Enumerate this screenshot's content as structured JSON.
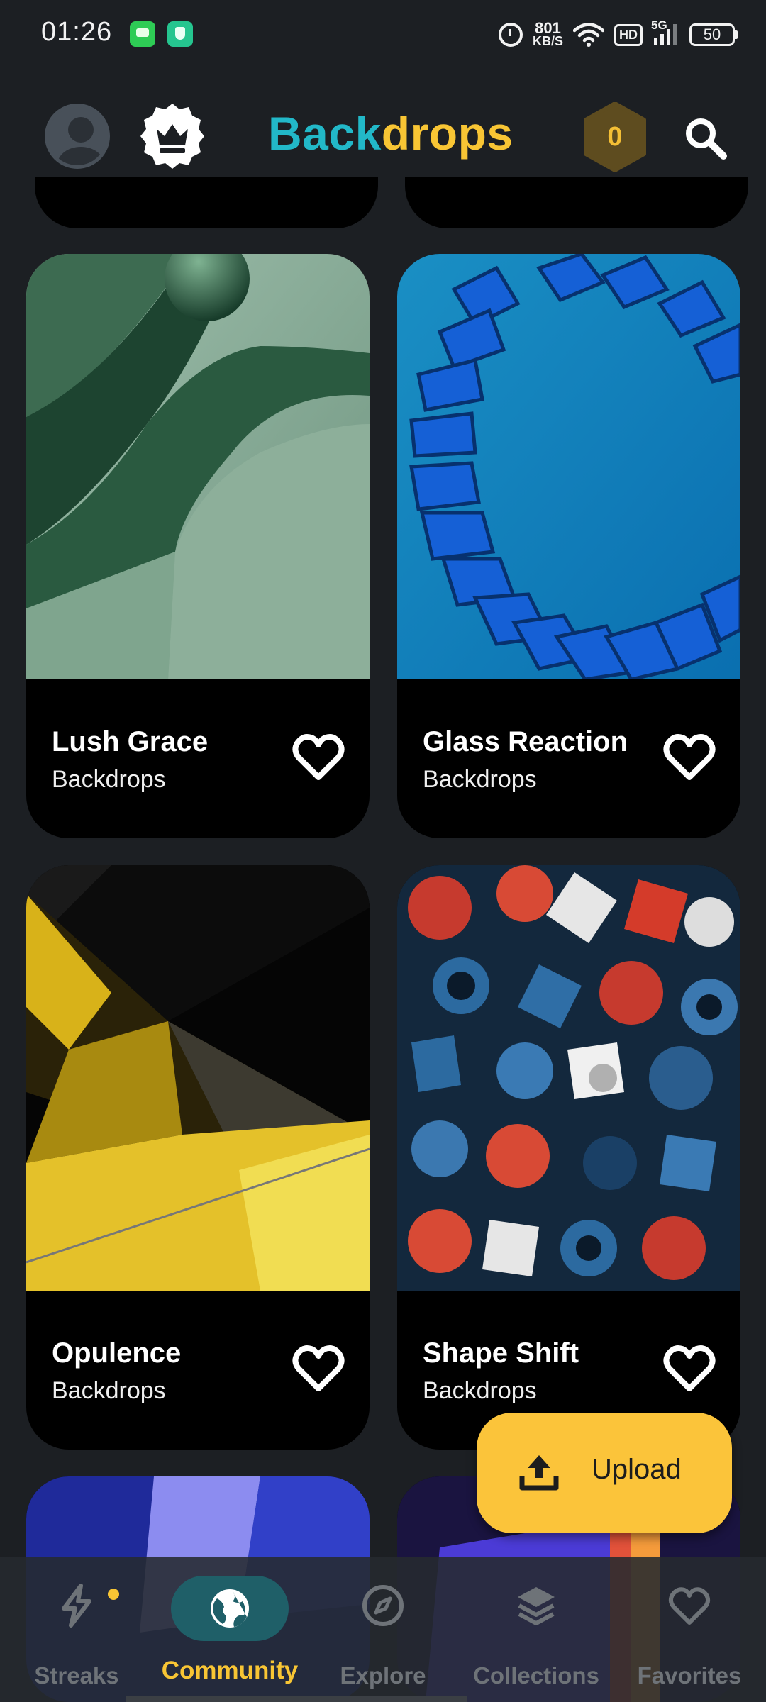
{
  "status_bar": {
    "time": "01:26",
    "speed_value": "801",
    "speed_unit": "KB/S",
    "hd": "HD",
    "network": "5G",
    "battery": "50"
  },
  "header": {
    "brand_part1": "Back",
    "brand_part2": "drops",
    "coins": "0"
  },
  "cards": [
    {
      "title": "Lush Grace",
      "subtitle": "Backdrops"
    },
    {
      "title": "Glass Reaction",
      "subtitle": "Backdrops"
    },
    {
      "title": "Opulence",
      "subtitle": "Backdrops"
    },
    {
      "title": "Shape Shift",
      "subtitle": "Backdrops"
    }
  ],
  "upload": {
    "label": "Upload"
  },
  "nav": {
    "items": [
      {
        "label": "Streaks",
        "icon": "lightning-icon"
      },
      {
        "label": "Community",
        "icon": "globe-icon",
        "active": true
      },
      {
        "label": "Explore",
        "icon": "compass-icon"
      },
      {
        "label": "Collections",
        "icon": "layers-icon"
      },
      {
        "label": "Favorites",
        "icon": "heart-icon"
      }
    ]
  },
  "colors": {
    "background": "#1c1f23",
    "brand_teal": "#22b8c8",
    "brand_yellow": "#f8c534",
    "upload_bg": "#fbc43a",
    "nav_active_pill": "#1f5f68"
  }
}
